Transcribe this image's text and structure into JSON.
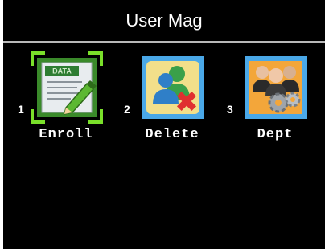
{
  "title": "User Mag",
  "items": [
    {
      "number": "1",
      "label": "Enroll",
      "icon": "enroll-data-pencil-icon",
      "selected": true,
      "badge": "DATA"
    },
    {
      "number": "2",
      "label": "Delete",
      "icon": "delete-user-icon",
      "selected": false
    },
    {
      "number": "3",
      "label": "Dept",
      "icon": "dept-people-gears-icon",
      "selected": false
    }
  ],
  "colors": {
    "background": "#000000",
    "text": "#ffffff",
    "selection": "#7ae02a"
  }
}
